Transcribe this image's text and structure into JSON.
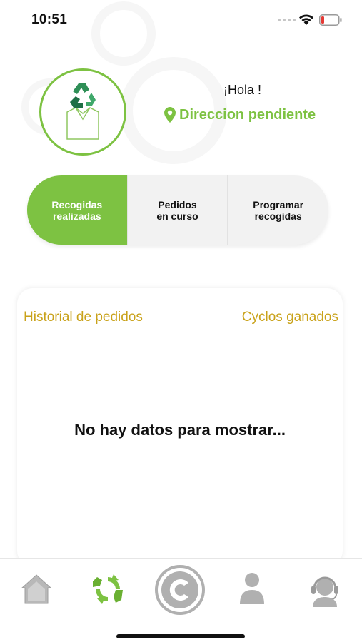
{
  "status_bar": {
    "time": "10:51",
    "icons": [
      "signal-dots-icon",
      "wifi-icon",
      "battery-low-icon"
    ],
    "battery_color": "#e53935"
  },
  "profile": {
    "avatar_icon": "recycling-shirt-icon",
    "greeting": "¡Hola !",
    "address_icon": "location-pin-icon",
    "address": "Direccion pendiente"
  },
  "tabs": [
    {
      "label": "Recogidas\nrealizadas",
      "active": true
    },
    {
      "label": "Pedidos\nen curso",
      "active": false
    },
    {
      "label": "Programar\nrecogidas",
      "active": false
    }
  ],
  "history_card": {
    "left_header": "Historial de pedidos",
    "right_header": "Cyclos ganados",
    "empty_message": "No hay datos para mostrar..."
  },
  "bottom_nav": {
    "items": [
      "home-icon",
      "recycle-icon",
      "cyclos-c-icon",
      "profile-icon",
      "support-headset-icon"
    ],
    "active": "recycle-icon"
  },
  "colors": {
    "accent_green": "#7dc242",
    "gold_text": "#c9a21a",
    "inactive_icon": "#b0b0b0"
  }
}
